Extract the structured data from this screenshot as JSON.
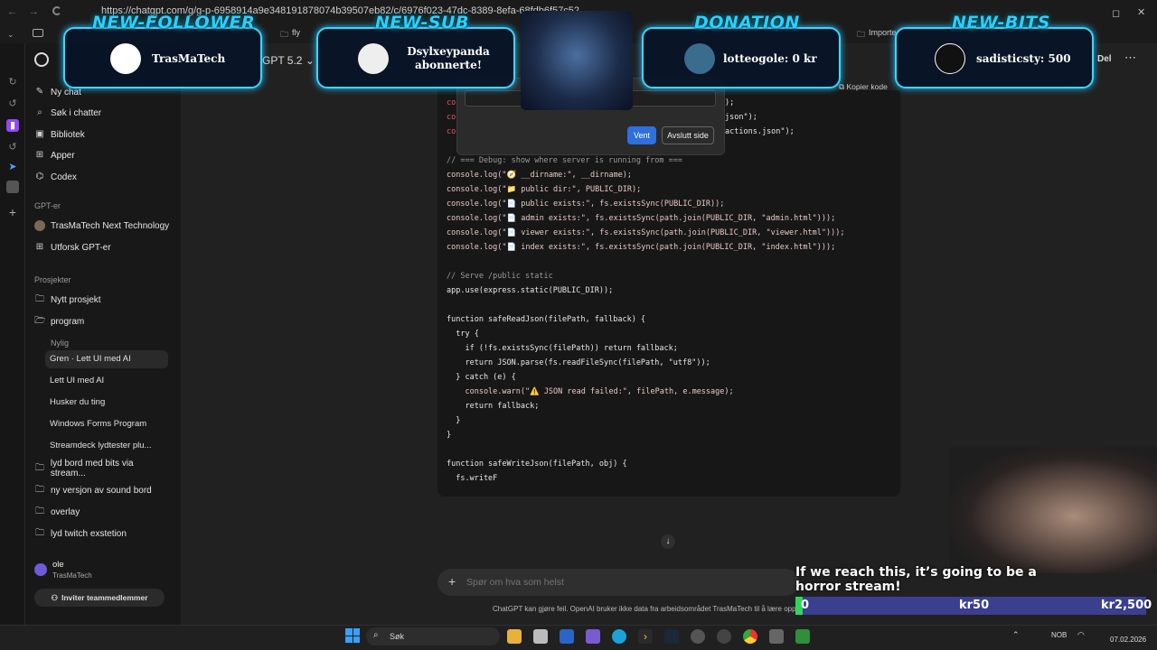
{
  "browser": {
    "url": "https://chatgpt.com/g/g-p-6958914a9e348191878074b39507eb82/c/6976f023-47dc-8389-8efa-68fdb6f57c52",
    "bookmarks": [
      "fly",
      "Importe"
    ],
    "share_label": "Del"
  },
  "header": {
    "model": "GPT 5.2",
    "copy_code": "Kopier kode"
  },
  "sidebar": {
    "items": [
      {
        "label": "Ny chat",
        "icon": "edit-icon"
      },
      {
        "label": "Søk i chatter",
        "icon": "search-icon"
      },
      {
        "label": "Bibliotek",
        "icon": "library-icon"
      },
      {
        "label": "Apper",
        "icon": "apps-icon"
      },
      {
        "label": "Codex",
        "icon": "codex-icon"
      }
    ],
    "gpts_heading": "GPT-er",
    "gpts": [
      {
        "label": "TrasMaTech Next Technology",
        "icon": "gpt-avatar-icon"
      },
      {
        "label": "Utforsk GPT-er",
        "icon": "explore-icon"
      }
    ],
    "projects_heading": "Prosjekter",
    "projects_top": [
      {
        "label": "Nytt prosjekt",
        "icon": "new-folder-icon"
      },
      {
        "label": "program",
        "icon": "folder-open-icon"
      }
    ],
    "recent_heading": "Nylig",
    "recent": [
      "Gren · Lett UI med AI",
      "Lett UI med AI",
      "Husker du ting",
      "Windows Forms Program",
      "Streamdeck lydtester plu..."
    ],
    "projects_more": [
      "lyd bord med bits via stream...",
      "ny versjon av sound bord",
      "overlay",
      "lyd twitch exstetion"
    ],
    "user": {
      "name": "ole",
      "org": "TrasMaTech"
    },
    "invite": "Inviter teammedlemmer"
  },
  "dialog": {
    "ok": "Vent",
    "cancel": "Avslutt side"
  },
  "code": {
    "partial_top": [
      "co",
      "co",
      "co"
    ],
    "partial_right": [
      ");",
      "json\");",
      "actions.json\");"
    ],
    "lines": [
      "// === Debug: show where server is running from ===",
      "console.log(\"🧭 __dirname:\", __dirname);",
      "console.log(\"📁 public dir:\", PUBLIC_DIR);",
      "console.log(\"📄 public exists:\", fs.existsSync(PUBLIC_DIR));",
      "console.log(\"📄 admin exists:\", fs.existsSync(path.join(PUBLIC_DIR, \"admin.html\")));",
      "console.log(\"📄 viewer exists:\", fs.existsSync(path.join(PUBLIC_DIR, \"viewer.html\")));",
      "console.log(\"📄 index exists:\", fs.existsSync(path.join(PUBLIC_DIR, \"index.html\")));",
      "",
      "// Serve /public static",
      "app.use(express.static(PUBLIC_DIR));",
      "",
      "function safeReadJson(filePath, fallback) {",
      "  try {",
      "    if (!fs.existsSync(filePath)) return fallback;",
      "    return JSON.parse(fs.readFileSync(filePath, \"utf8\"));",
      "  } catch (e) {",
      "    console.warn(\"⚠️ JSON read failed:\", filePath, e.message);",
      "    return fallback;",
      "  }",
      "}",
      "",
      "function safeWriteJson(filePath, obj) {",
      "  fs.writeF"
    ]
  },
  "chat": {
    "placeholder": "Spør om hva som helst",
    "disclaimer": "ChatGPT kan gjøre feil. OpenAI bruker ikke data fra arbeidsområdet TrasMaTech til å lære opp n"
  },
  "alerts": [
    {
      "title": "NEW-FOLLOWER",
      "text": "TrasMaTech"
    },
    {
      "title": "NEW-SUB",
      "text": "Dsylxeypanda abonnerte!"
    },
    {
      "title": "DONATION",
      "text": "lotteogole: 0 kr"
    },
    {
      "title": "NEW-BITS",
      "text": "sadisticsty: 500"
    }
  ],
  "goal": {
    "text": "If we reach this, it’s going to be a horror stream!",
    "start": "0",
    "mid": "kr50",
    "end": "kr2,500",
    "progress": 0.0
  },
  "taskbar": {
    "search": "Søk",
    "lang": "NOB",
    "date": "07.02.2026"
  },
  "colors": {
    "accent": "#2f6fde",
    "alert_border": "#38d8ff",
    "goal_bar": "#3b3f8f",
    "goal_fill": "#2ed65a"
  }
}
